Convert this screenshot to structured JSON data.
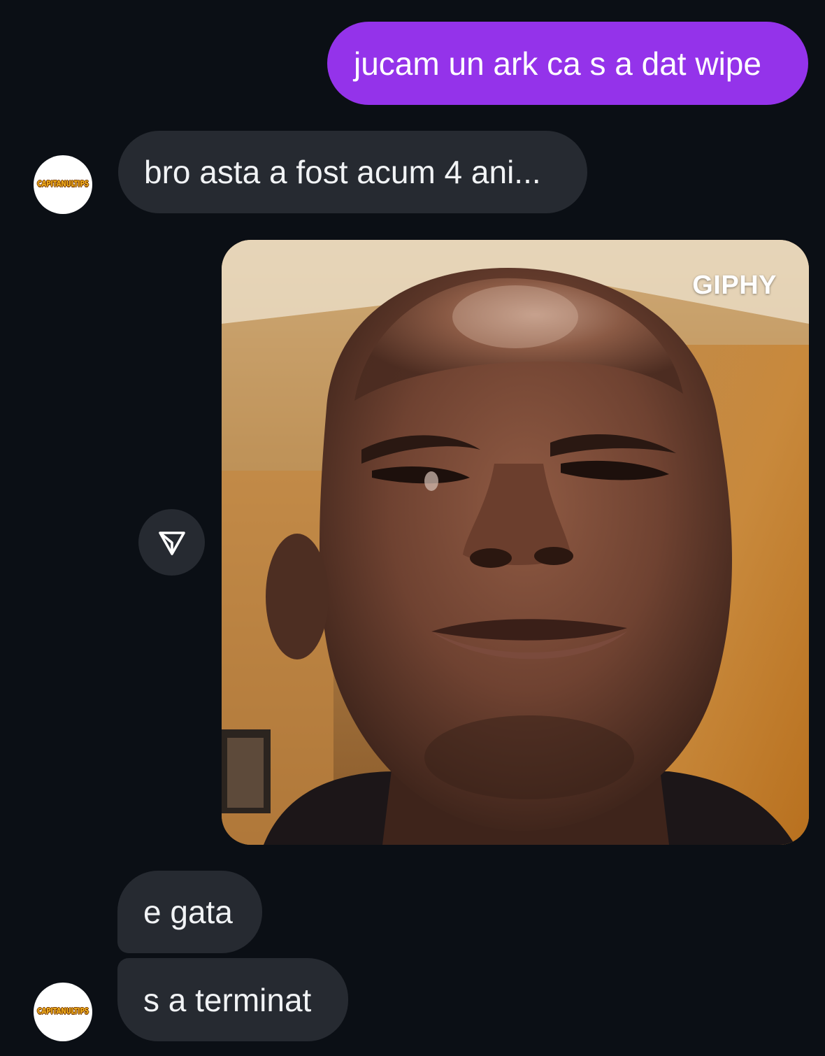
{
  "messages": [
    {
      "direction": "outgoing",
      "text": "jucam un ark ca s a dat wipe"
    },
    {
      "direction": "incoming",
      "text": "bro asta a fost acum 4 ani..."
    },
    {
      "direction": "outgoing",
      "type": "gif",
      "label": "GIPHY"
    },
    {
      "direction": "incoming",
      "text": "e gata"
    },
    {
      "direction": "incoming",
      "text": "s a terminat"
    }
  ],
  "contact": {
    "avatar_text": "CAPITANULTIPS"
  },
  "icons": {
    "share": "send-share-icon"
  },
  "colors": {
    "background": "#0b0f15",
    "outgoing_bubble": "#9433ea",
    "incoming_bubble": "#262a31",
    "text": "#f1f3f5"
  }
}
